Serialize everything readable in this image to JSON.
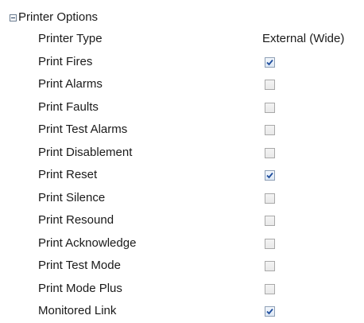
{
  "group": {
    "title": "Printer Options"
  },
  "printer_type": {
    "label": "Printer Type",
    "value": "External (Wide)"
  },
  "options": [
    {
      "label": "Print Fires",
      "checked": true
    },
    {
      "label": "Print Alarms",
      "checked": false
    },
    {
      "label": "Print Faults",
      "checked": false
    },
    {
      "label": "Print Test Alarms",
      "checked": false
    },
    {
      "label": "Print Disablement",
      "checked": false
    },
    {
      "label": "Print Reset",
      "checked": true
    },
    {
      "label": "Print Silence",
      "checked": false
    },
    {
      "label": "Print Resound",
      "checked": false
    },
    {
      "label": "Print Acknowledge",
      "checked": false
    },
    {
      "label": "Print Test Mode",
      "checked": false
    },
    {
      "label": "Print Mode Plus",
      "checked": false
    },
    {
      "label": "Monitored Link",
      "checked": true
    }
  ],
  "colors": {
    "checkmark": "#1f4e9e"
  }
}
